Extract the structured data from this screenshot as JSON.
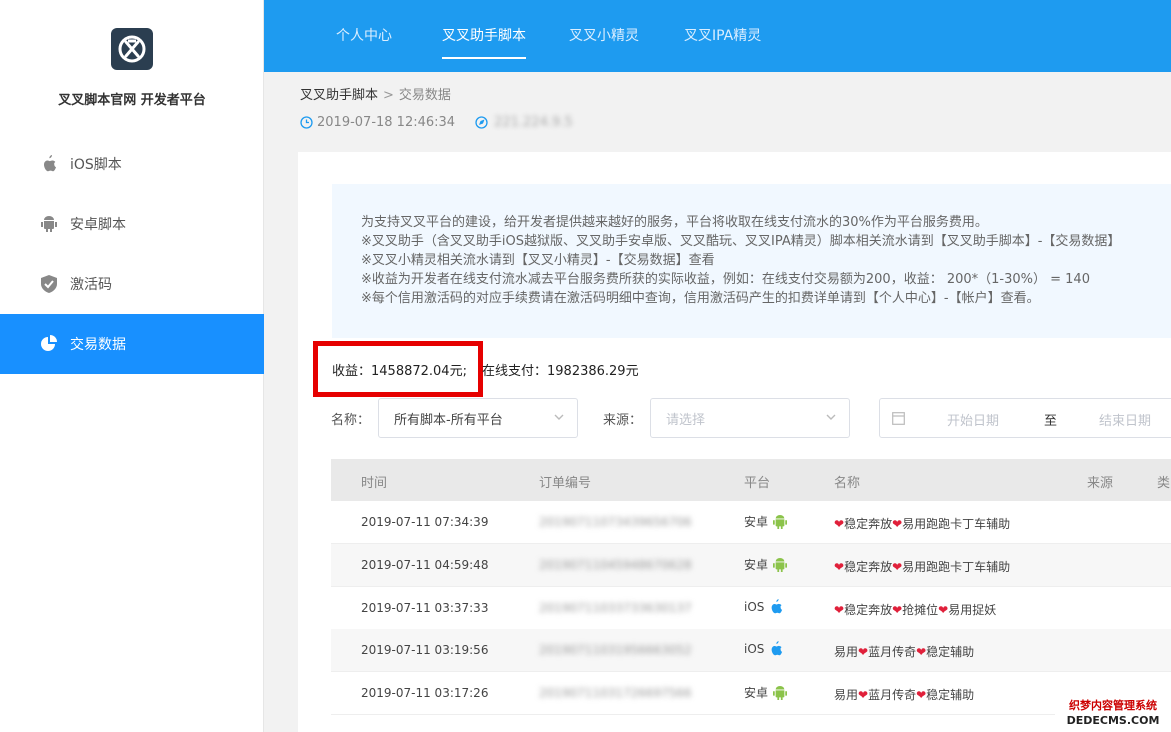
{
  "brand": "叉叉脚本官网 开发者平台",
  "sidebar": {
    "items": [
      {
        "label": "iOS脚本",
        "icon": "apple-icon"
      },
      {
        "label": "安卓脚本",
        "icon": "android-icon"
      },
      {
        "label": "激活码",
        "icon": "shield-check-icon"
      },
      {
        "label": "交易数据",
        "icon": "pie-chart-icon"
      }
    ],
    "active_index": 3
  },
  "topnav": {
    "tabs": [
      "个人中心",
      "叉叉助手脚本",
      "叉叉小精灵",
      "叉叉IPA精灵"
    ],
    "active_index": 1
  },
  "breadcrumb": {
    "parent": "叉叉助手脚本",
    "sep": ">",
    "current": "交易数据"
  },
  "meta": {
    "datetime": "2019-07-18 12:46:34",
    "ip": "221.224.9.5"
  },
  "notice": {
    "lines": [
      "为支持叉叉平台的建设，给开发者提供越来越好的服务，平台将收取在线支付流水的30%作为平台服务费用。",
      "※叉叉助手（含叉叉助手iOS越狱版、叉叉助手安卓版、叉叉酷玩、叉叉IPA精灵）脚本相关流水请到【叉叉助手脚本】-【交易数据】",
      "※叉叉小精灵相关流水请到【叉叉小精灵】-【交易数据】查看",
      "※收益为开发者在线支付流水减去平台服务费所获的实际收益，例如：在线支付交易额为200，收益： 200*（1-30%） = 140",
      "※每个信用激活码的对应手续费请在激活码明细中查询，信用激活码产生的扣费详单请到【个人中心】-【帐户】查看。"
    ]
  },
  "summary": {
    "income": "收益：1458872.04元;",
    "online": "在线支付：1982386.29元"
  },
  "filters": {
    "name_label": "名称：",
    "name_value": "所有脚本-所有平台",
    "source_label": "来源：",
    "source_placeholder": "请选择",
    "start_placeholder": "开始日期",
    "to": "至",
    "end_placeholder": "结束日期"
  },
  "table": {
    "columns": [
      "时间",
      "订单编号",
      "平台",
      "名称",
      "来源",
      "类"
    ],
    "rows": [
      {
        "time": "2019-07-11 07:34:39",
        "order": "20190711073439656706",
        "platform": "安卓",
        "picon": "android",
        "name_html": "<span class='h'>❤</span>稳定奔放<span class='h'>❤</span>易用跑跑卡丁车辅助"
      },
      {
        "time": "2019-07-11 04:59:48",
        "order": "20190711045948670628",
        "platform": "安卓",
        "picon": "android",
        "name_html": "<span class='h'>❤</span>稳定奔放<span class='h'>❤</span>易用跑跑卡丁车辅助"
      },
      {
        "time": "2019-07-11 03:37:33",
        "order": "20190711033733630137",
        "platform": "iOS",
        "picon": "apple",
        "name_html": "<span class='h'>❤</span>稳定奔放<span class='h'>❤</span>抢摊位<span class='h'>❤</span>易用捉妖"
      },
      {
        "time": "2019-07-11 03:19:56",
        "order": "20190711031956663052",
        "platform": "iOS",
        "picon": "apple",
        "name_html": "易用<span class='h'>❤</span>蓝月传奇<span class='h'>❤</span>稳定辅助"
      },
      {
        "time": "2019-07-11 03:17:26",
        "order": "20190711031726697566",
        "platform": "安卓",
        "picon": "android",
        "name_html": "易用<span class='h'>❤</span>蓝月传奇<span class='h'>❤</span>稳定辅助"
      }
    ]
  },
  "watermark": {
    "line1": "织梦内容管理系统",
    "line2": "DEDECMS.COM"
  },
  "colors": {
    "primary": "#1e9bf0",
    "active": "#1890ff",
    "highlight": "#e60000",
    "android": "#8bc34a",
    "apple": "#1e9bf0",
    "heart": "#e0203a"
  }
}
